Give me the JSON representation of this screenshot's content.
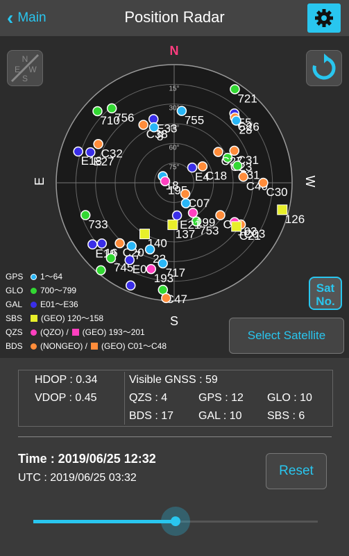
{
  "header": {
    "back_label": "Main",
    "title": "Position Radar"
  },
  "radar": {
    "directions": {
      "n": "N",
      "s": "S",
      "e": "E",
      "w": "W"
    },
    "elevations": [
      "15°",
      "30°",
      "45°",
      "60°",
      "75°"
    ],
    "satellites": [
      {
        "label": "721",
        "type": "glo",
        "az": 327,
        "el": 5
      },
      {
        "label": "E5",
        "type": "gal",
        "az": 319,
        "el": 20
      },
      {
        "label": "C26",
        "type": "bds",
        "az": 317,
        "el": 22
      },
      {
        "label": "28",
        "type": "gps",
        "az": 315,
        "el": 23
      },
      {
        "label": "710",
        "type": "glo",
        "az": 47,
        "el": 10
      },
      {
        "label": "756",
        "type": "glo",
        "az": 40,
        "el": 16
      },
      {
        "label": "755",
        "type": "gps",
        "az": 354,
        "el": 35
      },
      {
        "label": "E33",
        "type": "gal",
        "az": 18,
        "el": 39
      },
      {
        "label": "C38",
        "type": "bds",
        "az": 28,
        "el": 40
      },
      {
        "label": "8",
        "type": "gps",
        "az": 20,
        "el": 45
      },
      {
        "label": "C32",
        "type": "bds",
        "az": 63,
        "el": 25
      },
      {
        "label": "E27",
        "type": "gal",
        "az": 70,
        "el": 22
      },
      {
        "label": "E18",
        "type": "gal",
        "az": 72,
        "el": 13
      },
      {
        "label": "C31",
        "type": "bds",
        "az": 298,
        "el": 38
      },
      {
        "label": "C23",
        "type": "glo",
        "az": 295,
        "el": 45
      },
      {
        "label": "C27",
        "type": "bds",
        "az": 305,
        "el": 49
      },
      {
        "label": "731",
        "type": "glo",
        "az": 285,
        "el": 40
      },
      {
        "label": "C40",
        "type": "bds",
        "az": 275,
        "el": 37
      },
      {
        "label": "C30",
        "type": "bds",
        "az": 270,
        "el": 22
      },
      {
        "label": "18",
        "type": "gps",
        "az": 60,
        "el": 80
      },
      {
        "label": "195",
        "type": "qzs",
        "az": 80,
        "el": 83
      },
      {
        "label": "C18",
        "type": "bds",
        "az": 300,
        "el": 65
      },
      {
        "label": "E4",
        "type": "gal",
        "az": 310,
        "el": 72
      },
      {
        "label": "733",
        "type": "glo",
        "az": 110,
        "el": 18
      },
      {
        "label": "C07",
        "type": "bds",
        "az": 225,
        "el": 78
      },
      {
        "label": "1",
        "type": "gps",
        "az": 210,
        "el": 72
      },
      {
        "label": "126",
        "type": "sbs",
        "az": 256,
        "el": 5
      },
      {
        "label": "C08",
        "type": "bds",
        "az": 235,
        "el": 47
      },
      {
        "label": "753",
        "type": "glo",
        "az": 210,
        "el": 56
      },
      {
        "label": "C03",
        "type": "bds",
        "az": 238,
        "el": 30
      },
      {
        "label": "193",
        "type": "qzs",
        "az": 237,
        "el": 35
      },
      {
        "label": "199",
        "type": "qzs",
        "az": 212,
        "el": 63
      },
      {
        "label": "C21",
        "type": "sbs",
        "az": 235,
        "el": 32
      },
      {
        "label": "140",
        "type": "sbs",
        "az": 150,
        "el": 45
      },
      {
        "label": "E21",
        "type": "gal",
        "az": 185,
        "el": 65
      },
      {
        "label": "137",
        "type": "sbs",
        "az": 178,
        "el": 58
      },
      {
        "label": "C20",
        "type": "bds",
        "az": 138,
        "el": 28
      },
      {
        "label": "16",
        "type": "gal",
        "az": 130,
        "el": 18
      },
      {
        "label": "E19",
        "type": "gal",
        "az": 127,
        "el": 12
      },
      {
        "label": "7",
        "type": "gps",
        "az": 146,
        "el": 32
      },
      {
        "label": "22",
        "type": "gps",
        "az": 160,
        "el": 36
      },
      {
        "label": "745",
        "type": "glo",
        "az": 140,
        "el": 15
      },
      {
        "label": "E01",
        "type": "gal",
        "az": 150,
        "el": 22
      },
      {
        "label": "193",
        "type": "qzs",
        "az": 165,
        "el": 22
      },
      {
        "label": "717",
        "type": "gps",
        "az": 172,
        "el": 28
      },
      {
        "label": "C47",
        "type": "glo",
        "az": 174,
        "el": 8
      },
      {
        "label": "",
        "type": "bds",
        "az": 176,
        "el": 2
      },
      {
        "label": "",
        "type": "gal",
        "az": 157,
        "el": 5
      },
      {
        "label": "",
        "type": "glo",
        "az": 140,
        "el": 3
      }
    ]
  },
  "controls": {
    "sat_no": [
      "Sat",
      "No."
    ],
    "select_label": "Select Satellite"
  },
  "legend": [
    {
      "key": "GPS",
      "desc": "1～64",
      "color": "#29b6f6",
      "shape": "dot"
    },
    {
      "key": "GLO",
      "desc": "700～799",
      "color": "#33d833",
      "shape": "dot"
    },
    {
      "key": "GAL",
      "desc": "E01～E36",
      "color": "#3a2ee8",
      "shape": "dot"
    },
    {
      "key": "SBS",
      "desc": "(GEO) 120～158",
      "color": "#e8ef2a",
      "shape": "sq"
    },
    {
      "key": "QZS",
      "desc1": "(QZO) /",
      "desc2": "(GEO) 193～201",
      "color": "#ff40c0",
      "shape": "dot+sq"
    },
    {
      "key": "BDS",
      "desc1": "(NONGEO) /",
      "desc2": "(GEO) C01～C48",
      "color": "#ff8c3a",
      "shape": "dot+sq"
    }
  ],
  "stats": {
    "hdop": "HDOP : 0.34",
    "vdop": "VDOP : 0.45",
    "visible": "Visible GNSS : 59",
    "qzs": "QZS : 4",
    "gps": "GPS : 12",
    "glo": "GLO : 10",
    "bds": "BDS : 17",
    "gal": "GAL : 10",
    "sbs": "SBS : 6"
  },
  "time": {
    "local": "Time : 2019/06/25 12:32",
    "utc": "UTC : 2019/06/25 03:32"
  },
  "reset_label": "Reset",
  "slider": {
    "value": 0.5
  },
  "colors": {
    "accent": "#29c6ef"
  }
}
